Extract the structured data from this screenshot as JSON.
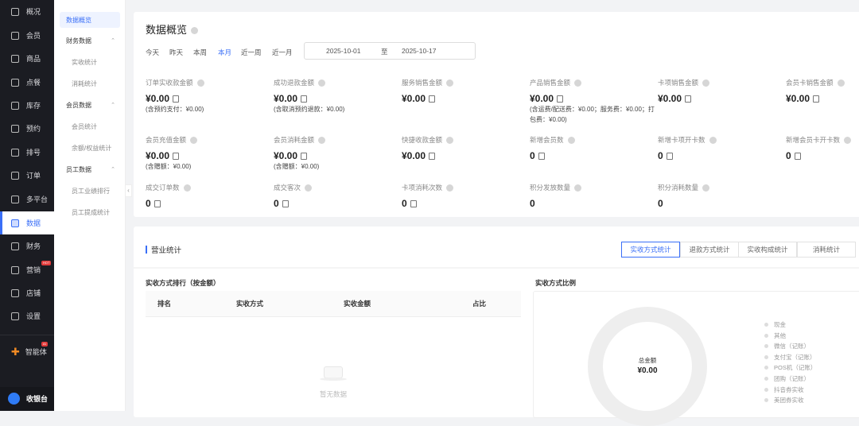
{
  "nav": {
    "items": [
      {
        "label": "概况",
        "icon": "grid-icon"
      },
      {
        "label": "会员",
        "icon": "crown-icon"
      },
      {
        "label": "商品",
        "icon": "box-icon"
      },
      {
        "label": "点餐",
        "icon": "dish-icon"
      },
      {
        "label": "库存",
        "icon": "warehouse-icon"
      },
      {
        "label": "预约",
        "icon": "calendar-check-icon"
      },
      {
        "label": "排号",
        "icon": "ticket-icon"
      },
      {
        "label": "订单",
        "icon": "clipboard-icon"
      },
      {
        "label": "多平台",
        "icon": "layers-icon"
      },
      {
        "label": "数据",
        "icon": "chart-monitor-icon"
      },
      {
        "label": "财务",
        "icon": "finance-icon"
      },
      {
        "label": "营销",
        "icon": "marketing-icon",
        "badge": "HOT"
      },
      {
        "label": "店铺",
        "icon": "store-icon"
      },
      {
        "label": "设置",
        "icon": "gear-icon"
      }
    ],
    "ai": {
      "label": "智能体",
      "badge": "AI"
    },
    "cashier": {
      "label": "收银台"
    }
  },
  "subnav": {
    "items": [
      {
        "label": "数据概览",
        "type": "active"
      },
      {
        "label": "财务数据",
        "type": "group"
      },
      {
        "label": "实收统计",
        "type": "child"
      },
      {
        "label": "消耗统计",
        "type": "child"
      },
      {
        "label": "会员数据",
        "type": "group"
      },
      {
        "label": "会员统计",
        "type": "child"
      },
      {
        "label": "余额/权益统计",
        "type": "child"
      },
      {
        "label": "员工数据",
        "type": "group"
      },
      {
        "label": "员工业绩排行",
        "type": "child"
      },
      {
        "label": "员工提成统计",
        "type": "child"
      }
    ]
  },
  "overview": {
    "title": "数据概览",
    "ranges": [
      "今天",
      "昨天",
      "本周",
      "本月",
      "近一周",
      "近一月"
    ],
    "active_range": "本月",
    "date_start": "2025-10-01",
    "date_sep": "至",
    "date_end": "2025-10-17",
    "metrics": [
      {
        "label": "订单实收款金额",
        "value": "¥0.00",
        "sub": "(含预约支付：¥0.00)"
      },
      {
        "label": "成功退款金额",
        "value": "¥0.00",
        "sub": "(含取消预约退款：¥0.00)"
      },
      {
        "label": "服务销售金额",
        "value": "¥0.00"
      },
      {
        "label": "产品销售金额",
        "value": "¥0.00",
        "sub": "(含运费/配送费：¥0.00；服务费：¥0.00；打包费：¥0.00)"
      },
      {
        "label": "卡项销售金额",
        "value": "¥0.00"
      },
      {
        "label": "会员卡销售金额",
        "value": "¥0.00"
      },
      {
        "label": "会员充值金额",
        "value": "¥0.00",
        "sub": "(含赠额：¥0.00)"
      },
      {
        "label": "会员消耗金额",
        "value": "¥0.00",
        "sub": "(含赠额：¥0.00)"
      },
      {
        "label": "快捷收款金额",
        "value": "¥0.00"
      },
      {
        "label": "新增会员数",
        "value": "0"
      },
      {
        "label": "新增卡项开卡数",
        "value": "0"
      },
      {
        "label": "新增会员卡开卡数",
        "value": "0"
      },
      {
        "label": "成交订单数",
        "value": "0"
      },
      {
        "label": "成交客次",
        "value": "0"
      },
      {
        "label": "卡项消耗次数",
        "value": "0"
      },
      {
        "label": "积分发放数量",
        "value": "0",
        "nodoc": true
      },
      {
        "label": "积分消耗数量",
        "value": "0",
        "nodoc": true
      }
    ]
  },
  "business": {
    "title": "营业统计",
    "tabs": [
      "实收方式统计",
      "退款方式统计",
      "实收构成统计",
      "消耗统计"
    ],
    "ranking_title": "实收方式排行（按金额）",
    "columns": [
      "排名",
      "实收方式",
      "实收金额",
      "占比"
    ],
    "empty": "暂无数据",
    "ratio_title": "实收方式比例",
    "total_label": "总金额",
    "total_value": "¥0.00",
    "legend": [
      "现金",
      "其他",
      "微信（记账）",
      "支付宝（记账）",
      "POS机（记账）",
      "团购（记账）",
      "抖音券实收",
      "美团券实收"
    ]
  }
}
